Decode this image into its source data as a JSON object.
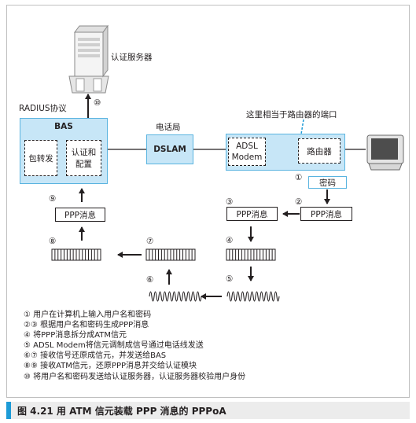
{
  "labels": {
    "auth_server": "认证服务器",
    "radius": "RADIUS协议",
    "telecom": "电话局",
    "router_port_note": "这里相当于路由器的端口"
  },
  "nodes": {
    "bas": "BAS",
    "packet_forward": "包转发",
    "auth_config": "认证和\n配置",
    "dslam": "DSLAM",
    "adsl_modem": "ADSL\nModem",
    "router": "路由器",
    "password": "密码",
    "ppp_msg": "PPP消息"
  },
  "steps": {
    "s1": "①",
    "s2": "②",
    "s3": "③",
    "s4": "④",
    "s5": "⑤",
    "s6": "⑥",
    "s7": "⑦",
    "s8": "⑧",
    "s9": "⑨",
    "s10": "⑩"
  },
  "legend": [
    "① 用户在计算机上输入用户名和密码",
    "②③ 根据用户名和密码生成PPP消息",
    "④ 将PPP消息拆分成ATM信元",
    "⑤ ADSL Modem将信元调制成信号通过电话线发送",
    "⑥⑦ 接收信号还原成信元，并发送给BAS",
    "⑧⑨ 接收ATM信元，还原PPP消息并交给认证模块",
    "⑩ 将用户名和密码发送给认证服务器，认证服务器校验用户身份"
  ],
  "caption": "图 4.21   用 ATM 信元装载 PPP 消息的 PPPoA",
  "colors": {
    "box_fill": "#c7e6f7",
    "box_border": "#5ab4e0",
    "accent": "#1d9bd7"
  }
}
